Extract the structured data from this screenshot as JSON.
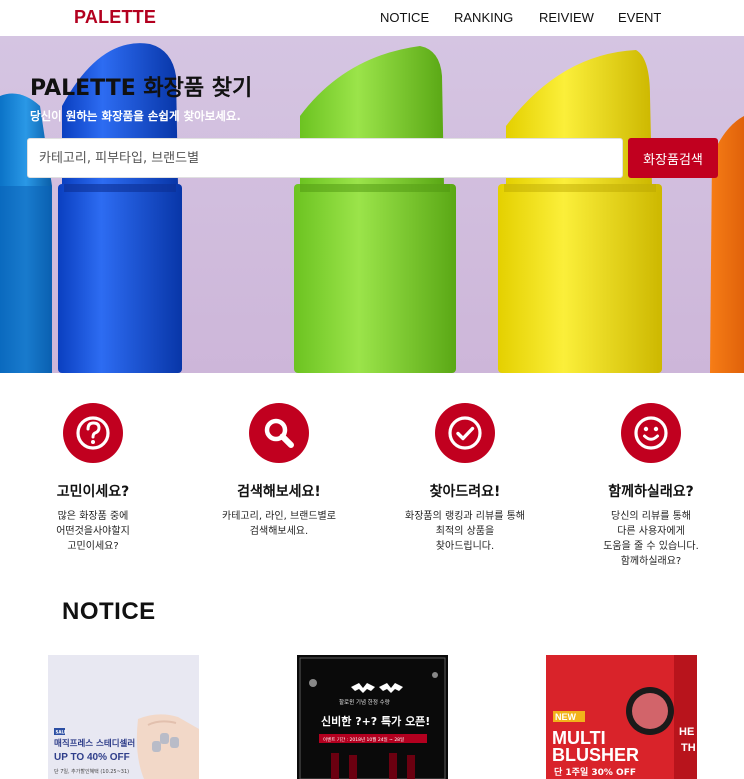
{
  "nav": {
    "logo": "PALETTE",
    "links": [
      "NOTICE",
      "RANKING",
      "REIVIEW",
      "EVENT"
    ]
  },
  "hero": {
    "title": "PALETTE 화장품 찾기",
    "subtitle": "당신이 원하는 화장품을 손쉽게 찾아보세요.",
    "search_placeholder": "카테고리, 피부타입, 브랜드별",
    "search_button": "화장품검색"
  },
  "features": [
    {
      "icon": "question-icon",
      "title": "고민이세요?",
      "desc": "많은 화장품 중에\n어떤것을사야할지\n고민이세요?"
    },
    {
      "icon": "search-icon",
      "title": "검색해보세요!",
      "desc": "카테고리, 라인, 브랜드별로\n검색해보세요."
    },
    {
      "icon": "check-icon",
      "title": "찾아드려요!",
      "desc": "화장품의 랭킹과 리뷰를 통해\n최적의 상품을\n찾아드립니다."
    },
    {
      "icon": "smile-icon",
      "title": "함께하실래요?",
      "desc": "당신의 리뷰를 통해\n다른 사용자에게\n도움을 줄 수 있습니다.\n함께하실래요?"
    }
  ],
  "notice": {
    "title": "NOTICE",
    "cards": [
      {
        "badge": "SALE",
        "title": "매직프레스 스테디셀러",
        "headline": "UP TO 40% OFF",
        "date": "단 7일, 추가할인혜택 (10.25~31)"
      },
      {
        "brand": "할로윈 기념 한정 수량",
        "title": "신비한 ?+? 특가 오픈!",
        "date": "이벤트 기간 : 2018년 10월 24일 ~ 28일"
      },
      {
        "badge": "NEW",
        "headline": "MULTI BLUSHER",
        "date": "단 1주일 30% OFF",
        "side": "HE TH"
      }
    ]
  },
  "colors": {
    "brand": "#c1001f",
    "logo": "#b3001f"
  }
}
